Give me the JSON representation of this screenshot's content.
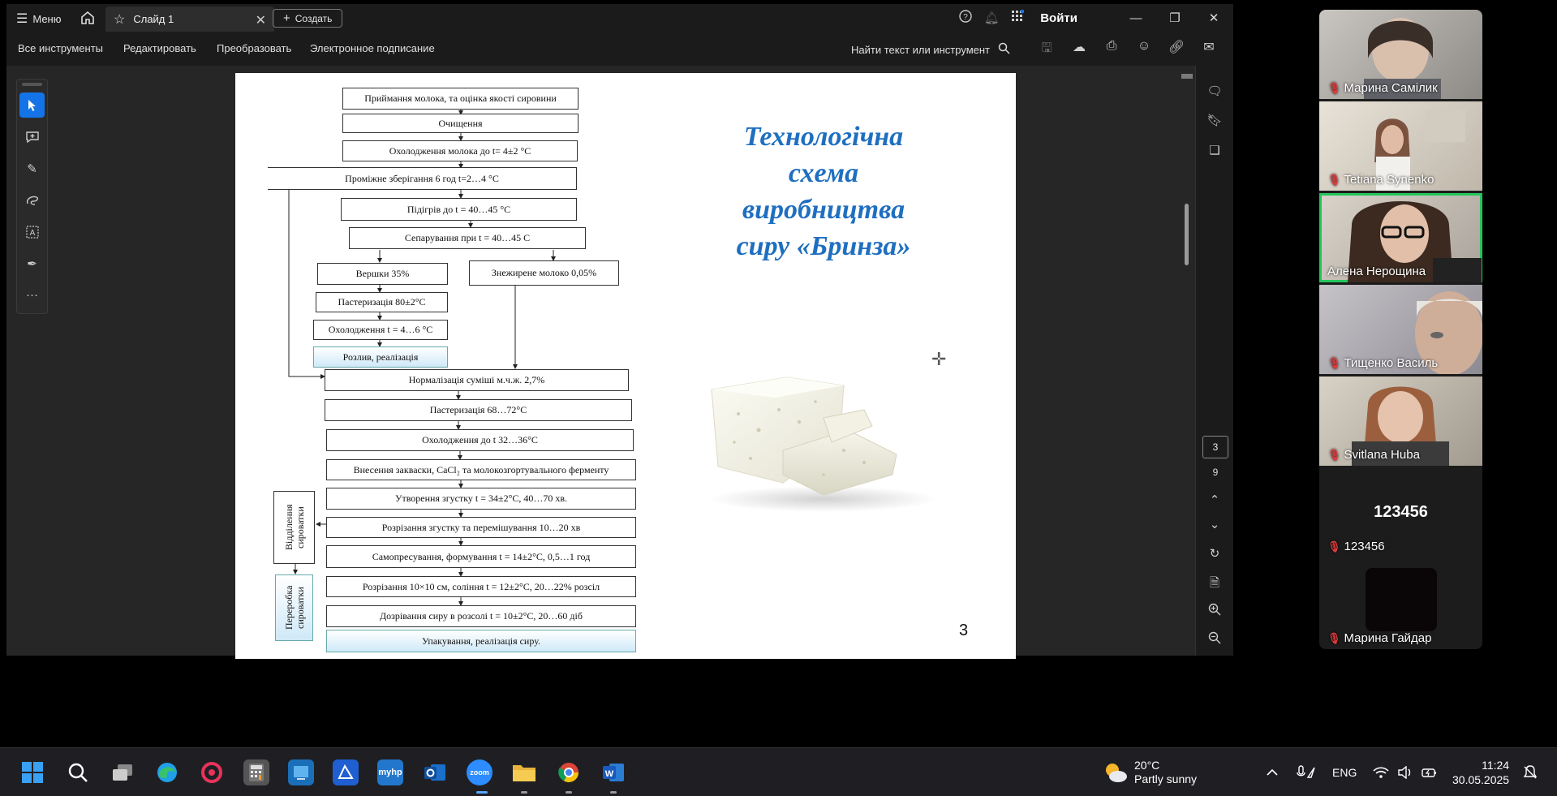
{
  "titlebar": {
    "menu_label": "Меню",
    "tab_title": "Слайд 1",
    "create_label": "Создать",
    "login_label": "Войти"
  },
  "toolbar": {
    "items": [
      "Все инструменты",
      "Редактировать",
      "Преобразовать",
      "Электронное подписание"
    ],
    "find_label": "Найти текст или инструмент"
  },
  "slide": {
    "title_lines": [
      "Технологічна",
      "схема",
      "виробництва",
      "сиру «Бринза»"
    ],
    "page_number": "3",
    "flow": {
      "b1": "Приймання молока, та оцінка якості сировини",
      "b2": "Очищення",
      "b3": "Охолодження молока до t= 4±2 °C",
      "b4": "Проміжне зберігання 6 год t=2…4 °C",
      "b5": "Підігрів до t = 40…45 °C",
      "b6": "Сепарування при t = 40…45 C",
      "b7": "Вершки 35%",
      "b8": "Знежирене молоко 0,05%",
      "b9": "Пастеризація 80±2°C",
      "b10": "Охолодження t = 4…6 °C",
      "b11": "Розлив, реалізація",
      "b12": "Нормалізація суміші м.ч.ж. 2,7%",
      "b13": "Пастеризація 68…72°C",
      "b14": "Охолодження до t 32…36°C",
      "b15": "Внесення закваски, CaCl₂ та молокозгортувального ферменту",
      "b16": "Утворення згустку t = 34±2°C, 40…70 хв.",
      "b17": "Розрізання згустку та перемішування 10…20 хв",
      "b18": "Самопресування, формування  t = 14±2°C, 0,5…1 год",
      "b19": "Розрізання 10×10 см, соління t = 12±2°C, 20…22% розсіл",
      "b20": "Дозрівання сиру в розсолі t = 10±2°C, 20…60 діб",
      "b21": "Упакування, реалізація сиру.",
      "side1": "Відділення сироватки",
      "side2": "Переробка сироватки"
    }
  },
  "pager": {
    "current": "3",
    "total": "9"
  },
  "participants": [
    {
      "name": "Марина Самілик"
    },
    {
      "name": "Tetiana Synenko"
    },
    {
      "name": "Алена Нерощина"
    },
    {
      "name": "Тищенко Василь"
    },
    {
      "name": "Svitlana Huba"
    },
    {
      "name": "123456",
      "big": "123456"
    },
    {
      "name": "Марина Гайдар"
    }
  ],
  "taskbar": {
    "weather_temp": "20°C",
    "weather_desc": "Partly sunny",
    "lang": "ENG",
    "time": "11:24",
    "date": "30.05.2025",
    "zoom_label": "zoom",
    "myhp_label": "myhp"
  },
  "colors": {
    "accent": "#1473e6",
    "title_blue": "#1f6fc0",
    "active_speaker": "#24c65c"
  }
}
